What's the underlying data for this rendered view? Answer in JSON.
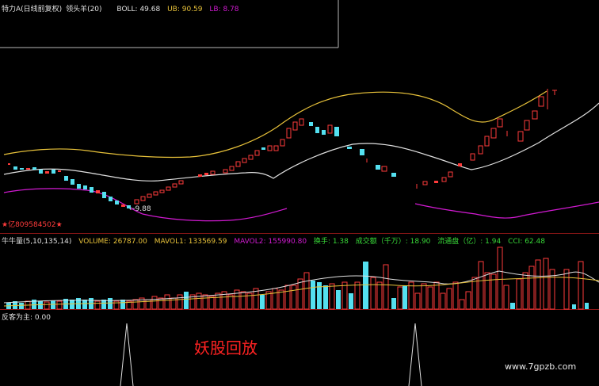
{
  "main_header": {
    "title": "特力A(日线前复权)",
    "indicator_name": "领头羊(20)",
    "boll": "BOLL: 49.68",
    "ub": "UB: 90.59",
    "lb": "LB: 8.78"
  },
  "price_labels": {
    "low_marker": "←9.88",
    "left_marker": "★亿809584502★"
  },
  "volume_header": {
    "name": "牛牛量(5,10,135,14)",
    "volume": "VOLUME: 26787.00",
    "mavol1": "MAVOL1: 133569.59",
    "mavol2": "MAVOL2: 155990.80",
    "turnover_rate": "换手: 1.38",
    "turnover_amount": "成交额（千万）: 18.90",
    "float_shares": "流通盘（亿）: 1.94",
    "cci": "CCI: 62.48"
  },
  "bottom_header": {
    "name": "反客为主: 0.00"
  },
  "overlay": {
    "caption": "妖股回放",
    "watermark": "www.7gpzb.com"
  },
  "colors": {
    "up": "#ff3b3b",
    "down": "#54e0f0",
    "upper_band": "#e8c23a",
    "mid_band": "#e0e0e0",
    "lower_band": "#d21ad2",
    "separator": "#8a1616"
  }
}
